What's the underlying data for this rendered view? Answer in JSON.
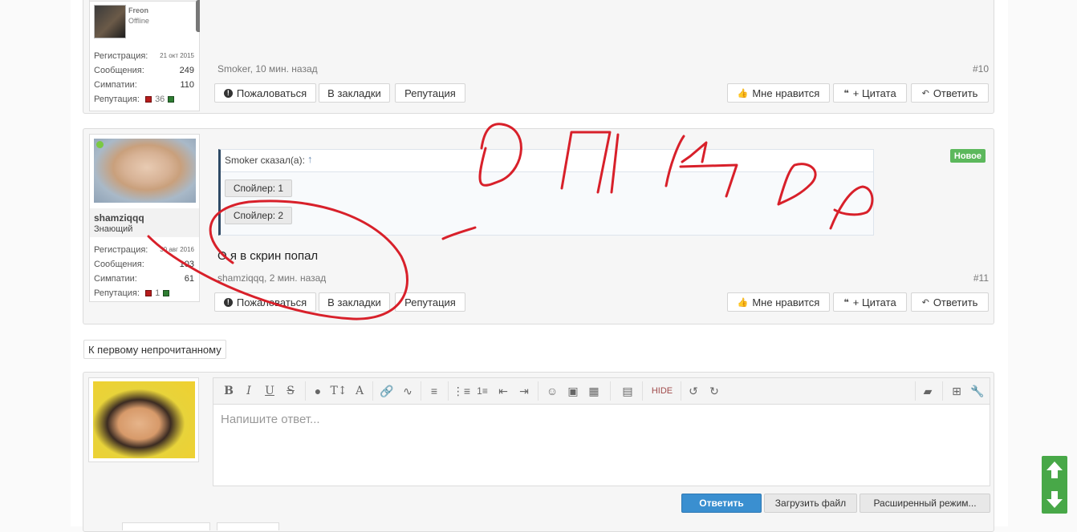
{
  "colors": {
    "accent_blue": "#3a8fd0",
    "badge_green": "#5cb85c",
    "scroll_green": "#48a848",
    "annotation_red": "#d8202a",
    "online_dot": "#7ac943"
  },
  "post10": {
    "user_name": "Freon",
    "user_status": "Offline",
    "stats": [
      {
        "label": "Регистрация:",
        "value": "21 окт 2015"
      },
      {
        "label": "Сообщения:",
        "value": "249"
      },
      {
        "label": "Симпатии:",
        "value": "110"
      },
      {
        "label": "Репутация:",
        "value": "36"
      }
    ],
    "meta": "Smoker, 10 мин. назад",
    "number": "#10"
  },
  "post11": {
    "username": "shamziqqq",
    "user_title": "Знающий",
    "stats": [
      {
        "label": "Регистрация:",
        "value": "30 авг 2016"
      },
      {
        "label": "Сообщения:",
        "value": "103"
      },
      {
        "label": "Симпатии:",
        "value": "61"
      },
      {
        "label": "Репутация:",
        "value": "1"
      }
    ],
    "quote_author": "Smoker сказал(а):",
    "spoiler1": "Спойлер: 1",
    "spoiler2": "Спойлер: 2",
    "badge": "Новое",
    "message": "О я в скрин попал",
    "meta": "shamziqqq, 2 мин. назад",
    "number": "#11"
  },
  "buttons": {
    "report": "Пожаловаться",
    "bookmark": "В закладки",
    "reputation": "Репутация",
    "like": "Мне нравится",
    "quote": "+ Цитата",
    "reply": "Ответить"
  },
  "unread_link": "К первому непрочитанному",
  "editor": {
    "placeholder": "Напишите ответ...",
    "hide_label": "HIDE",
    "submit": "Ответить",
    "upload": "Загрузить файл",
    "advanced": "Расширенный режим..."
  },
  "icons": [
    "bold-icon",
    "italic-icon",
    "underline-icon",
    "strikethrough-icon",
    "font-color-icon",
    "font-size-icon",
    "font-family-icon",
    "link-icon",
    "unlink-icon",
    "align-icon",
    "bullet-list-icon",
    "number-list-icon",
    "outdent-icon",
    "indent-icon",
    "smiley-icon",
    "image-icon",
    "media-icon",
    "save-draft-icon",
    "undo-icon",
    "redo-icon",
    "eraser-icon",
    "insert-icon",
    "wrench-icon",
    "arrow-up-icon",
    "arrow-down-icon"
  ]
}
